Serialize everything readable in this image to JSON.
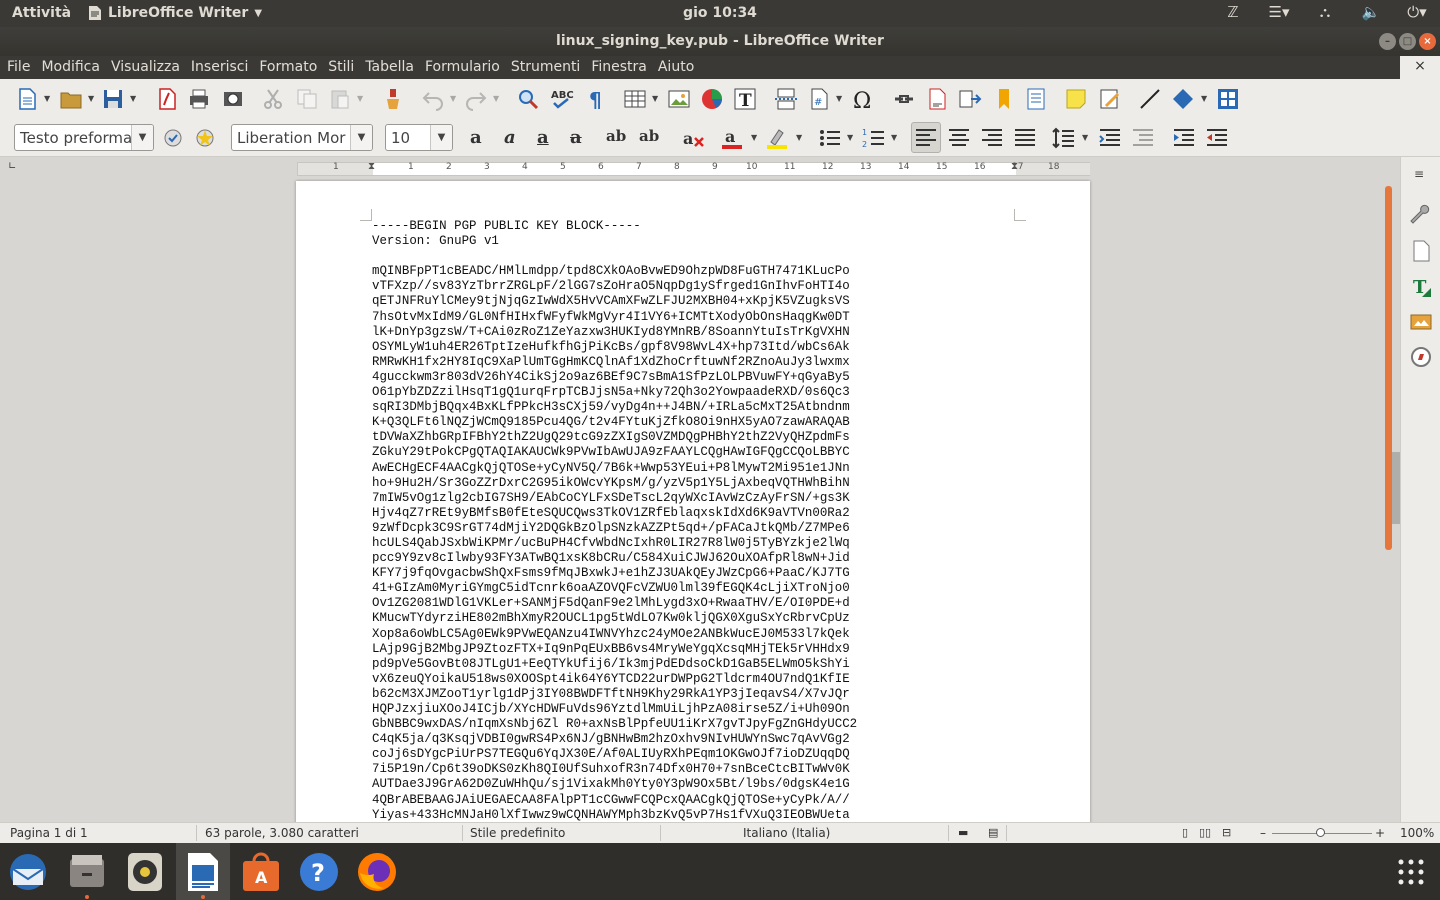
{
  "topbar": {
    "activities": "Attività",
    "app_name": "LibreOffice Writer",
    "clock": "gio 10:34"
  },
  "window": {
    "title": "linux_signing_key.pub - LibreOffice Writer"
  },
  "menu": [
    "File",
    "Modifica",
    "Visualizza",
    "Inserisci",
    "Formato",
    "Stili",
    "Tabella",
    "Formulario",
    "Strumenti",
    "Finestra",
    "Aiuto"
  ],
  "formatting": {
    "paragraph_style": "Testo preforma",
    "font_name": "Liberation Mor",
    "font_size": "10"
  },
  "ruler": {
    "ticks": [
      "1",
      "1",
      "2",
      "3",
      "4",
      "5",
      "6",
      "7",
      "8",
      "9",
      "10",
      "11",
      "12",
      "13",
      "14",
      "15",
      "16",
      "17",
      "18"
    ]
  },
  "document": {
    "header": "-----BEGIN PGP PUBLIC KEY BLOCK-----",
    "version": "Version: GnuPG v1",
    "lines": [
      "mQINBFpPT1cBEADC/HMlLmdpp/tpd8CXkOAoBvwED9OhzpWD8FuGTH7471KLucPo",
      "vTFXzp//sv83YzTbrrZRGLpF/2lGG7sZoHraO5NqpDg1ySfrged1GnIhvFoHTI4o",
      "qETJNFRuYlCMey9tjNjqGzIwWdX5HvVCAmXFwZLFJU2MXBH04+xKpjK5VZugksVS",
      "7hsOtvMxIdM9/GL0NfHIHxfWFyfWkMgVyr4I1VY6+ICMTtXodyObOnsHaqgKw0DT",
      "lK+DnYp3gzsW/T+CAi0zRoZ1ZeYazxw3HUKIyd8YMnRB/8SoannYtuIsTrKgVXHN",
      "OSYMLyW1uh4ER26TptIzeHufkfhGjPiKcBs/gpf8V98WvL4X+hp73Itd/wbCs6Ak",
      "RMRwKH1fx2HY8IqC9XaPlUmTGgHmKCQlnAf1XdZhoCrftuwNf2RZnoAuJy3lwxmx",
      "4gucckwm3r803dV26hY4CikSj2o9az6BEf9C7sBmA1SfPzLOLPBVuwFY+qGyaBy5",
      "O61pYbZDZzilHsqT1gQ1urqFrpTCBJjsN5a+Nky72Qh3o2YowpaadeRXD/0s6Qc3",
      "sqRI3DMbjBQqx4BxKLfPPkcH3sCXj59/vyDg4n++J4BN/+IRLa5cMxT25Atbndnm",
      "K+Q3QLFt6lNQZjWCmQ9185Pcu4QG/t2v4FYtuKjZfkO8Oi9nHX5yAO7zawARAQAB",
      "tDVWaXZhbGRpIFBhY2thZ2UgQ29tcG9zZXIgS0VZMDQgPHBhY2thZ2VyQHZpdmFs",
      "ZGkuY29tPokCPgQTAQIAKAUCWk9PVwIbAwUJA9zFAAYLCQgHAwIGFQgCCQoLBBYC",
      "AwECHgECF4AACgkQjQTOSe+yCyNV5Q/7B6k+Wwp53YEui+P8lMywT2Mi951e1JNn",
      "ho+9Hu2H/Sr3GoZZrDxrC2G95ikOWcvYKpsM/g/yzV5p1Y5LjAxbeqVQTHWhBihN",
      "7mIW5vOg1zlg2cbIG7SH9/EAbCoCYLFxSDeTscL2qyWXcIAvWzCzAyFrSN/+gs3K",
      "Hjv4qZ7rREt9yBMfsB0fEteSQUCQws3TkOV1ZRfEblaqxskIdXd6K9aVTVn00Ra2",
      "9zWfDcpk3C9SrGT74dMjiY2DQGkBzOlpSNzkAZZPt5qd+/pFACaJtkQMb/Z7MPe6",
      "hcULS4QabJSxbWiKPMr/ucBuPH4CfvWbdNcIxhR0LIR27R8lW0j5TyBYzkje2lWq",
      "pcc9Y9zv8cIlwby93FY3ATwBQ1xsK8bCRu/C584XuiCJWJ62OuXOAfpRl8wN+Jid",
      "KFY7j9fqOvgacbwShQxFsms9fMqJBxwkJ+e1hZJ3UAkQEyJWzCpG6+PaaC/KJ7TG",
      "41+GIzAm0MyriGYmgC5idTcnrk6oaAZOVQFcVZWU0lml39fEGQK4cLjiXTroNjo0",
      "Ov1ZG2081WDlG1VKLer+SANMjF5dQanF9e2lMhLygd3xO+RwaaTHV/E/OI0PDE+d",
      "KMucwTYdyrziHE802mBhXmyR2OUCL1pg5tWdLO7Kw0kljQGX0XguSxYcRbrvCpUz",
      "Xop8a6oWbLC5Ag0EWk9PVwEQANzu4IWNVYhzc24yMOe2ANBkWucEJ0M533l7kQek",
      "LAjp9GjB2MbgJP9ZtozFTX+Iq9nPqEUxBB6vs4MryWeYgqXcsqMHjTEk5rVHHdx9",
      "pd9pVe5GovBt08JTLgU1+EeQTYkUfij6/Ik3mjPdEDdsoCkD1GaB5ELWmO5kShYi",
      "vX6zeuQYoikaU518ws0XOOSpt4ik64Y6YTCD22urDWPpG2Tldcrm4OU7ndQ1KfIE",
      "b62cM3XJMZooT1yrlg1dPj3IY08BWDFTftNH9Khy29RkA1YP3jIeqavS4/X7vJQr",
      "HQPJzxjiuXOoJ4ICjb/XYcHDWFuVds96YztdlMmUiLjhPzA08irse5Z/i+Uh09On",
      "GbNBBC9wxDAS/nIqmXsNbj6Zl R0+axNsBlPpfeUU1iKrX7gvTJpyFgZnGHdyUCC2",
      "C4qK5ja/q3KsqjVDBI0gwRS4Px6NJ/gBNHwBm2hzOxhv9NIvHUWYnSwc7qAvVGg2",
      "coJj6sDYgcPiUrPS7TEGQu6YqJX30E/Af0ALIUyRXhPEqm1OKGwOJf7ioDZUqqDQ",
      "7i5P19n/Cp6t39oDKS0zKh8QI0UfSuhxofR3n74Dfx0H70+7snBceCtcBITwWv0K",
      "AUTDae3J9GrA62D0ZuWHhQu/sj1VixakMh0Yty0Y3pW9Ox5Bt/l9bs/0dgsK4e1G",
      "4QBrABEBAAGJAiUEGAECAA8FAlpPT1cCGwwFCQPcxQAACgkQjQTOSe+yCyPk/A//",
      "Yiyas+433HcMNJaH0lXfIwwz9wCQNHAWYMph3bzKvQ5vP7Hs1fVXuQ3IEOBWUeta"
    ]
  },
  "status": {
    "page": "Pagina 1 di 1",
    "words": "63 parole, 3.080 caratteri",
    "style": "Stile predefinito",
    "language": "Italiano (Italia)",
    "zoom": "100%"
  }
}
